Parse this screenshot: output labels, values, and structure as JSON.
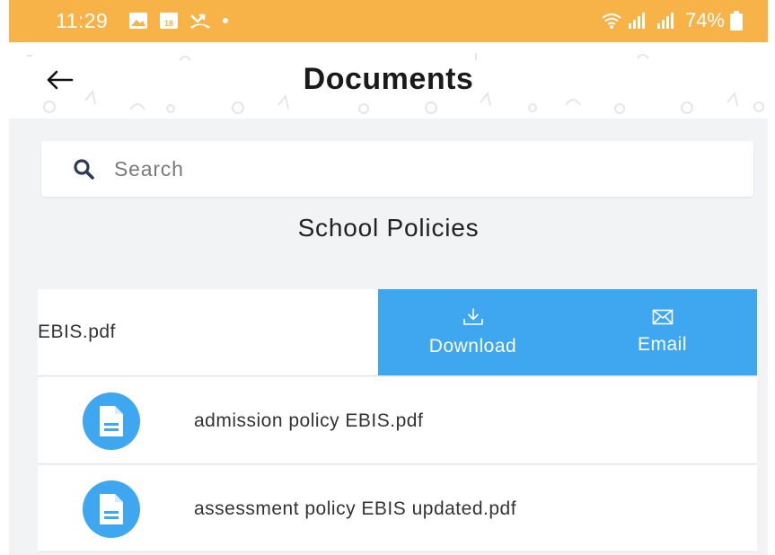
{
  "status_bar": {
    "time": "11:29",
    "battery": "74%",
    "icons": [
      "image-icon",
      "calendar-icon",
      "missed-call-icon",
      "dot-icon"
    ],
    "calendar_day": "18",
    "color": "#f7b248"
  },
  "header": {
    "title": "Documents",
    "back_icon": "arrow-left-icon"
  },
  "search": {
    "placeholder": "Search",
    "value": ""
  },
  "section": {
    "title": "School Policies"
  },
  "swiped_row": {
    "file_name_visible": "EBIS.pdf",
    "actions": [
      {
        "label": "Download",
        "icon": "download-icon"
      },
      {
        "label": "Email",
        "icon": "email-icon"
      }
    ],
    "action_color": "#3ea7ef"
  },
  "documents": [
    {
      "name": "admission policy EBIS.pdf",
      "icon": "document-icon"
    },
    {
      "name": "assessment policy EBIS updated.pdf",
      "icon": "document-icon"
    }
  ]
}
